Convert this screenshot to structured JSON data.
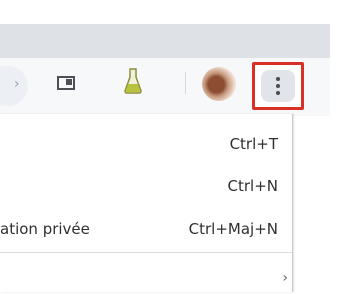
{
  "toolbar": {
    "icons": [
      {
        "name": "reader-mode-icon"
      },
      {
        "name": "labs-flask-icon"
      },
      {
        "name": "profile-avatar"
      },
      {
        "name": "kebab-menu-icon"
      }
    ],
    "menu_button_highlight": "#d93025",
    "flask_color": "#b8c23b"
  },
  "menu": {
    "items": [
      {
        "label": "",
        "shortcut": "Ctrl+T"
      },
      {
        "label": "",
        "shortcut": "Ctrl+N"
      },
      {
        "label": "ation privée",
        "shortcut": "Ctrl+Maj+N"
      }
    ]
  }
}
